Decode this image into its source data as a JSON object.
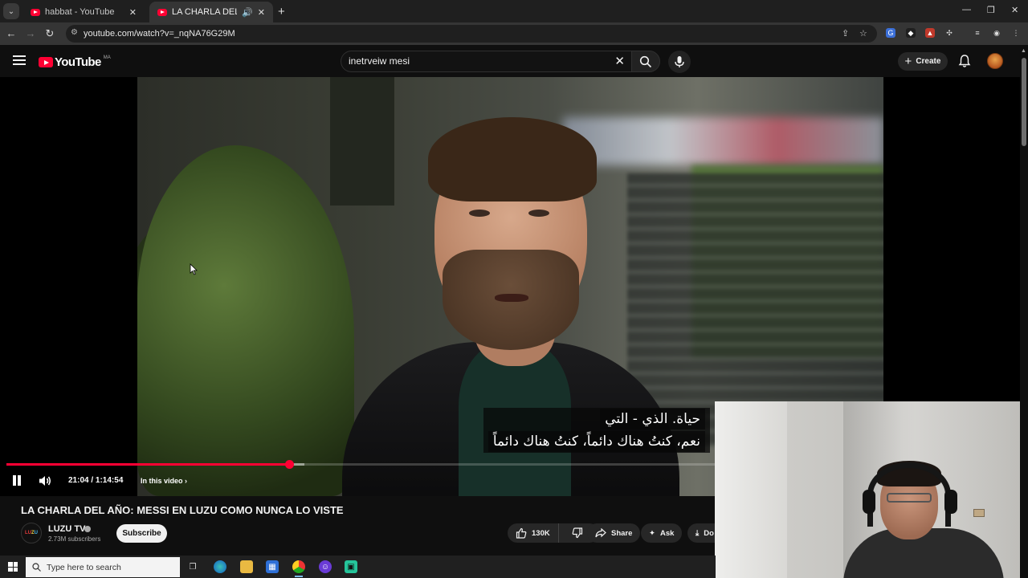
{
  "browser": {
    "tabs": [
      {
        "title": "habbat - YouTube",
        "active": false
      },
      {
        "title": "LA CHARLA DEL AÑO: MES",
        "active": true
      }
    ],
    "url": "youtube.com/watch?v=_nqNA76G29M"
  },
  "youtube": {
    "logo_text": "YouTube",
    "region": "MA",
    "search_value": "inetrveiw mesi",
    "create_label": "Create"
  },
  "player": {
    "subtitle_line1": "حياة. الذي - التي",
    "subtitle_line2": "نعم، كنتُ هناك دائماً، كنتُ هناك دائماً",
    "timecode": "21:04 / 1:14:54",
    "in_this_video": "In this video",
    "played_fraction": 0.281,
    "buffered_fraction": 0.296
  },
  "video": {
    "title": "LA CHARLA DEL AÑO: MESSI EN LUZU COMO NUNCA LO VISTE",
    "channel_name": "LUZU TV",
    "subscribers": "2.73M subscribers",
    "subscribe_label": "Subscribe",
    "likes": "130K",
    "share_label": "Share",
    "ask_label": "Ask",
    "download_label": "Do"
  },
  "channel_avatar_text": {
    "a": "LU",
    "b": "Z",
    "c": "U"
  },
  "taskbar": {
    "search_placeholder": "Type here to search"
  },
  "colors": {
    "youtube_red": "#ff0033",
    "background": "#0f0f0f"
  }
}
